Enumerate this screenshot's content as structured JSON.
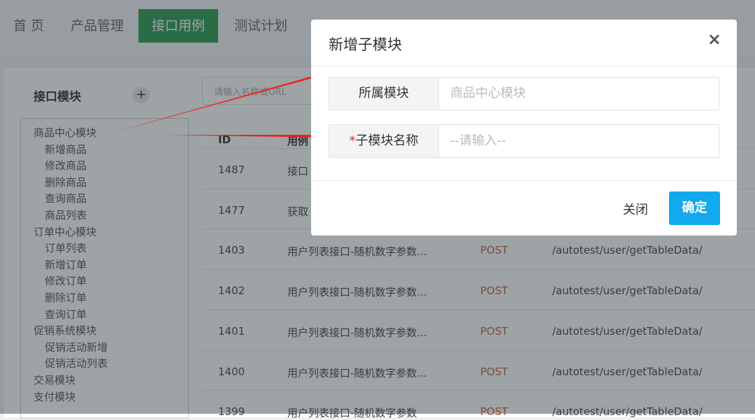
{
  "nav": {
    "items": [
      {
        "label": "首 页"
      },
      {
        "label": "产品管理"
      },
      {
        "label": "接口用例",
        "active": true
      },
      {
        "label": "测试计划"
      }
    ]
  },
  "sidebar": {
    "title": "接口模块",
    "add_icon": "plus-icon",
    "items": [
      {
        "label": "商品中心模块",
        "level": 0
      },
      {
        "label": "新增商品",
        "level": 1
      },
      {
        "label": "修改商品",
        "level": 1
      },
      {
        "label": "删除商品",
        "level": 1
      },
      {
        "label": "查询商品",
        "level": 1
      },
      {
        "label": "商品列表",
        "level": 1
      },
      {
        "label": "订单中心模块",
        "level": 0
      },
      {
        "label": "订单列表",
        "level": 1
      },
      {
        "label": "新增订单",
        "level": 1
      },
      {
        "label": "修改订单",
        "level": 1
      },
      {
        "label": "删除订单",
        "level": 1
      },
      {
        "label": "查询订单",
        "level": 1
      },
      {
        "label": "促销系统模块",
        "level": 0
      },
      {
        "label": "促销活动新增",
        "level": 1
      },
      {
        "label": "促销活动列表",
        "level": 1
      },
      {
        "label": "交易模块",
        "level": 0
      },
      {
        "label": "支付模块",
        "level": 0
      }
    ]
  },
  "search": {
    "placeholder": "请输入名称或URL"
  },
  "table": {
    "headers": [
      "ID",
      "用例"
    ],
    "rows": [
      {
        "id": "1487",
        "name": "接口",
        "method": "",
        "url": ""
      },
      {
        "id": "1477",
        "name": "获取",
        "method": "",
        "url": ""
      },
      {
        "id": "1403",
        "name": "用户列表接口-随机数字参数...",
        "method": "POST",
        "url": "/autotest/user/getTableData/"
      },
      {
        "id": "1402",
        "name": "用户列表接口-随机数字参数...",
        "method": "POST",
        "url": "/autotest/user/getTableData/"
      },
      {
        "id": "1401",
        "name": "用户列表接口-随机数字参数...",
        "method": "POST",
        "url": "/autotest/user/getTableData/"
      },
      {
        "id": "1400",
        "name": "用户列表接口-随机数字参数...",
        "method": "POST",
        "url": "/autotest/user/getTableData/"
      },
      {
        "id": "1399",
        "name": "用户列表接口-随机数字参数",
        "method": "POST",
        "url": "/autotest/user/getTableData/"
      }
    ]
  },
  "modal": {
    "title": "新增子模块",
    "close_icon": "×",
    "fields": [
      {
        "label": "所属模块",
        "required": false,
        "value": "商品中心模块"
      },
      {
        "label": "子模块名称",
        "required": true,
        "placeholder": "--请输入--"
      }
    ],
    "required_mark": "*",
    "cancel_label": "关闭",
    "confirm_label": "确定"
  },
  "colors": {
    "nav_active": "#2e9c53",
    "confirm": "#12a9ee",
    "method": "#c0603a",
    "arrow": "#f0201a"
  }
}
